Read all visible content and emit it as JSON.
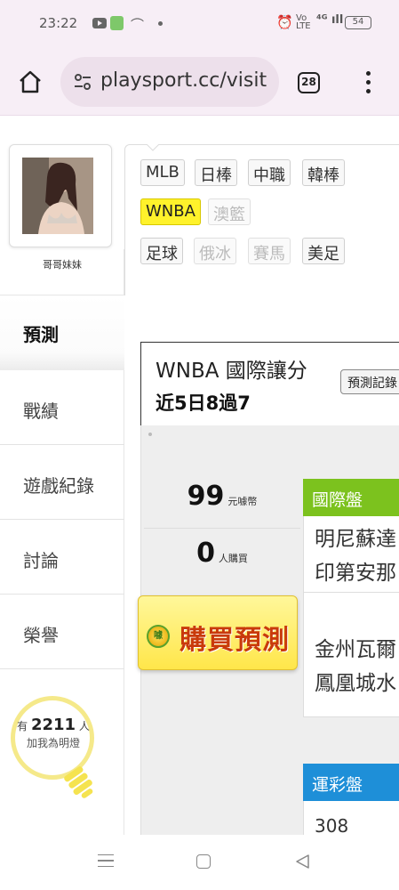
{
  "status_bar": {
    "time": "23:22",
    "signal": "⁴ᴳ ıll",
    "volte": "Vo LTE",
    "battery": "54"
  },
  "browser": {
    "url": "playsport.cc/visit",
    "tab_count": "28"
  },
  "profile": {
    "name": "哥哥妹妹"
  },
  "side_nav": {
    "active": "預測",
    "items": [
      "戰績",
      "遊戲紀錄",
      "討論",
      "榮譽"
    ]
  },
  "fans": {
    "prefix": "有",
    "count": "2211",
    "suffix": "人",
    "caption": "加我為明燈"
  },
  "league_tags": {
    "row1": [
      "MLB",
      "日棒",
      "中職",
      "韓棒"
    ],
    "row2": [
      "WNBA",
      "澳籃"
    ],
    "row3": [
      "足球",
      "俄冰",
      "賽馬",
      "美足"
    ],
    "selected": "WNBA",
    "disabled": [
      "澳籃",
      "俄冰",
      "賽馬"
    ]
  },
  "prediction": {
    "title": "WNBA 國際讓分",
    "record": "近5日8過7",
    "record_button": "預測記錄",
    "price": "99",
    "price_unit": "元噱幣",
    "buyers": "0",
    "buyers_unit": "人購買",
    "buy_button": "購買預測",
    "coin_label": "噱"
  },
  "markets": {
    "intl": {
      "label": "國際盤",
      "games": [
        [
          "明尼蘇達",
          "印第安那"
        ],
        [
          "金州瓦爾",
          "鳳凰城水"
        ]
      ]
    },
    "sports_lottery": {
      "label": "運彩盤",
      "first_line": "308"
    }
  },
  "colors": {
    "intl_header": "#7cc21e",
    "lottery_header": "#1e8fd8",
    "selected_tag": "#fff22b",
    "buy_button": "#ffe64a",
    "buy_text": "#c93a0b"
  }
}
